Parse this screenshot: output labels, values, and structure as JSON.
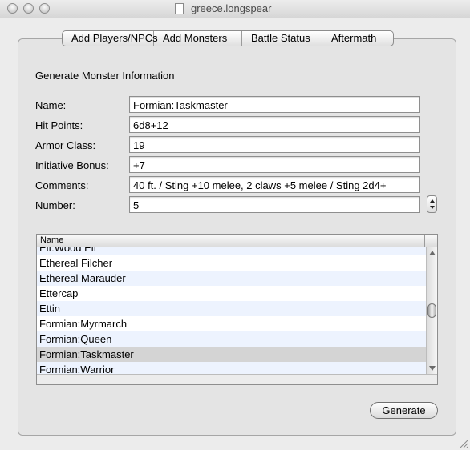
{
  "window": {
    "title": "greece.longspear"
  },
  "tabs": [
    {
      "label": "Add Players/NPCs"
    },
    {
      "label": "Add Monsters"
    },
    {
      "label": "Battle Status"
    },
    {
      "label": "Aftermath"
    }
  ],
  "form": {
    "section_title": "Generate Monster Information",
    "name_label": "Name:",
    "name_value": "Formian:Taskmaster",
    "hp_label": "Hit Points:",
    "hp_value": "6d8+12",
    "ac_label": "Armor Class:",
    "ac_value": "19",
    "init_label": "Initiative Bonus:",
    "init_value": "+7",
    "comments_label": "Comments:",
    "comments_value": "40 ft. / Sting +10 melee, 2 claws +5 melee / Sting 2d4+",
    "number_label": "Number:",
    "number_value": "5"
  },
  "monster_list": {
    "column_header": "Name",
    "rows": [
      "Elf:Wood Elf",
      "Ethereal Filcher",
      "Ethereal Marauder",
      "Ettercap",
      "Ettin",
      "Formian:Myrmarch",
      "Formian:Queen",
      "Formian:Taskmaster",
      "Formian:Warrior"
    ],
    "selected": "Formian:Taskmaster"
  },
  "generate_button": {
    "label": "Generate"
  }
}
